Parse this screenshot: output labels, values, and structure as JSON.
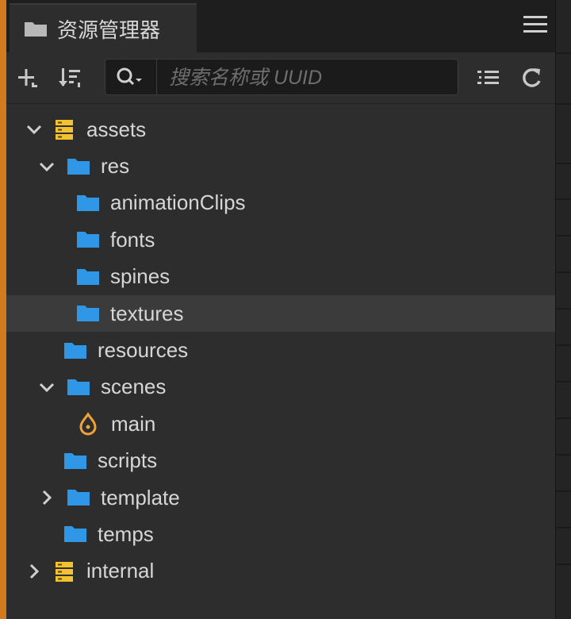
{
  "tab": {
    "title": "资源管理器",
    "icon": "folder-icon"
  },
  "toolbar": {
    "add_icon": "add-icon",
    "sort_icon": "sort-icon",
    "search_placeholder": "搜索名称或 UUID",
    "search_value": "",
    "collapse_icon": "collapse-list-icon",
    "refresh_icon": "refresh-icon"
  },
  "tree": [
    {
      "label": "assets",
      "type": "database",
      "depth": 0,
      "expanded": true
    },
    {
      "label": "res",
      "type": "folder",
      "depth": 1,
      "expanded": true
    },
    {
      "label": "animationClips",
      "type": "folder",
      "depth": 2
    },
    {
      "label": "fonts",
      "type": "folder",
      "depth": 2
    },
    {
      "label": "spines",
      "type": "folder",
      "depth": 2
    },
    {
      "label": "textures",
      "type": "folder",
      "depth": 2,
      "selected": true
    },
    {
      "label": "resources",
      "type": "folder",
      "depth": 1
    },
    {
      "label": "scenes",
      "type": "folder",
      "depth": 1,
      "expanded": true
    },
    {
      "label": "main",
      "type": "scene",
      "depth": 2
    },
    {
      "label": "scripts",
      "type": "folder",
      "depth": 1
    },
    {
      "label": "template",
      "type": "folder",
      "depth": 1,
      "expanded": false
    },
    {
      "label": "temps",
      "type": "folder",
      "depth": 1
    },
    {
      "label": "internal",
      "type": "database",
      "depth": 0,
      "expanded": false
    }
  ],
  "colors": {
    "folder": "#2f97e6",
    "database": "#f2c230",
    "scene": "#f0a23a",
    "accent": "#d17a1e"
  }
}
